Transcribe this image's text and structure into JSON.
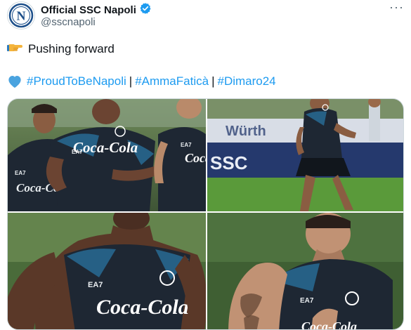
{
  "account": {
    "display_name": "Official SSC Napoli",
    "handle": "@sscnapoli",
    "verified": true,
    "verified_color": "#1d9bf0",
    "avatar_logo_letter": "N"
  },
  "menu": {
    "more_label": "···"
  },
  "post": {
    "line1_emoji_icon": "pointing-hand-icon",
    "line1_text": "Pushing forward",
    "heart_icon_color": "#4aa3df",
    "hashtags": [
      "#ProudToBeNapoli",
      "#AmmaFaticà",
      "#Dimaro24"
    ],
    "separator": "|"
  },
  "media": {
    "photo_count": 4,
    "colors": {
      "jersey": "#1e2733",
      "jersey_accent": "#2e90c8",
      "grass": "#5a9a3a",
      "skin": "#9a6a4a"
    },
    "jersey_sponsor": "Coca-Cola",
    "jersey_kit_brand": "EA7",
    "background_banner_text": "SSC"
  }
}
